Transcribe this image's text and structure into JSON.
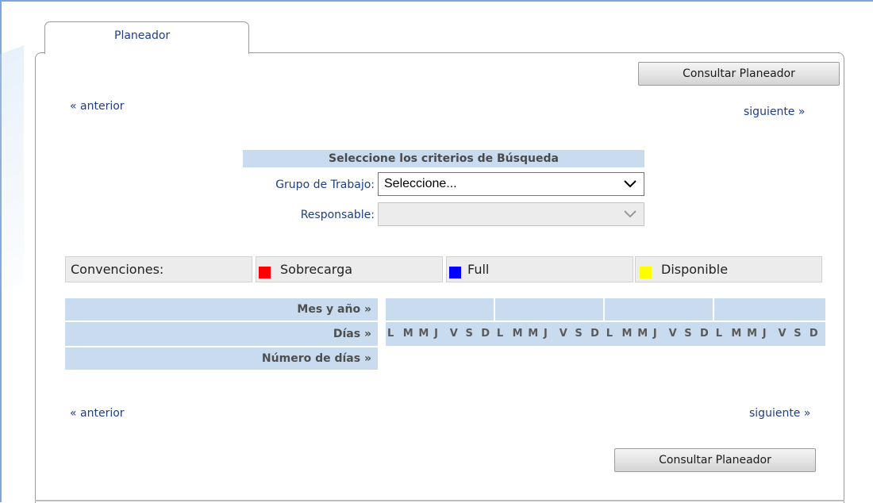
{
  "tab": {
    "label": "Planeador"
  },
  "buttons": {
    "consultar_top": "Consultar Planeador",
    "consultar_bottom": "Consultar Planeador"
  },
  "nav": {
    "prev_top": "« anterior",
    "next_top": "siguiente »",
    "prev_bottom": "« anterior",
    "next_bottom": "siguiente »"
  },
  "criteria": {
    "title": "Seleccione los criterios de Búsqueda",
    "grupo_label": "Grupo de Trabajo:",
    "grupo_value": "Seleccione...",
    "responsable_label": "Responsable:",
    "responsable_value": ""
  },
  "legend": {
    "title": "Convenciones:",
    "items": [
      {
        "label": "Sobrecarga",
        "color": "#ff0000"
      },
      {
        "label": "Full",
        "color": "#0000ff"
      },
      {
        "label": "Disponible",
        "color": "#ffff00"
      }
    ]
  },
  "grid": {
    "row_mes": "Mes y año »",
    "row_dias": "Días »",
    "row_numero": "Número de días »",
    "days": [
      "L",
      "M",
      "M",
      "J",
      "V",
      "S",
      "D",
      "L",
      "M",
      "M",
      "J",
      "V",
      "S",
      "D",
      "L",
      "M",
      "M",
      "J",
      "V",
      "S",
      "D",
      "L",
      "M",
      "M",
      "J",
      "V",
      "S",
      "D"
    ]
  },
  "colors": {
    "header_bg": "#c9dbee",
    "link": "#1f3d86"
  }
}
